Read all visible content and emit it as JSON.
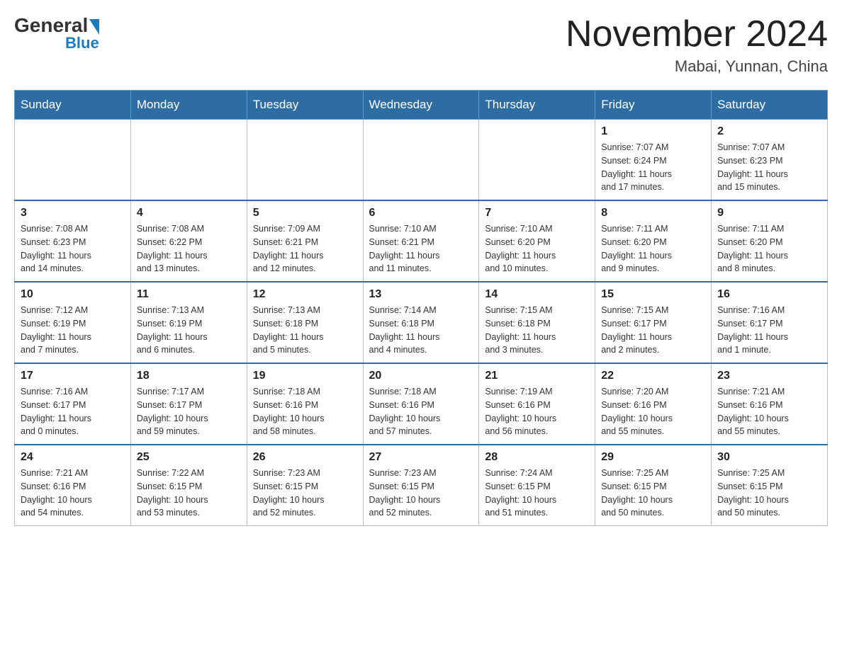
{
  "header": {
    "logo_general": "General",
    "logo_blue": "Blue",
    "month_title": "November 2024",
    "location": "Mabai, Yunnan, China"
  },
  "days_of_week": [
    "Sunday",
    "Monday",
    "Tuesday",
    "Wednesday",
    "Thursday",
    "Friday",
    "Saturday"
  ],
  "weeks": [
    {
      "days": [
        {
          "num": "",
          "info": ""
        },
        {
          "num": "",
          "info": ""
        },
        {
          "num": "",
          "info": ""
        },
        {
          "num": "",
          "info": ""
        },
        {
          "num": "",
          "info": ""
        },
        {
          "num": "1",
          "info": "Sunrise: 7:07 AM\nSunset: 6:24 PM\nDaylight: 11 hours\nand 17 minutes."
        },
        {
          "num": "2",
          "info": "Sunrise: 7:07 AM\nSunset: 6:23 PM\nDaylight: 11 hours\nand 15 minutes."
        }
      ]
    },
    {
      "days": [
        {
          "num": "3",
          "info": "Sunrise: 7:08 AM\nSunset: 6:23 PM\nDaylight: 11 hours\nand 14 minutes."
        },
        {
          "num": "4",
          "info": "Sunrise: 7:08 AM\nSunset: 6:22 PM\nDaylight: 11 hours\nand 13 minutes."
        },
        {
          "num": "5",
          "info": "Sunrise: 7:09 AM\nSunset: 6:21 PM\nDaylight: 11 hours\nand 12 minutes."
        },
        {
          "num": "6",
          "info": "Sunrise: 7:10 AM\nSunset: 6:21 PM\nDaylight: 11 hours\nand 11 minutes."
        },
        {
          "num": "7",
          "info": "Sunrise: 7:10 AM\nSunset: 6:20 PM\nDaylight: 11 hours\nand 10 minutes."
        },
        {
          "num": "8",
          "info": "Sunrise: 7:11 AM\nSunset: 6:20 PM\nDaylight: 11 hours\nand 9 minutes."
        },
        {
          "num": "9",
          "info": "Sunrise: 7:11 AM\nSunset: 6:20 PM\nDaylight: 11 hours\nand 8 minutes."
        }
      ]
    },
    {
      "days": [
        {
          "num": "10",
          "info": "Sunrise: 7:12 AM\nSunset: 6:19 PM\nDaylight: 11 hours\nand 7 minutes."
        },
        {
          "num": "11",
          "info": "Sunrise: 7:13 AM\nSunset: 6:19 PM\nDaylight: 11 hours\nand 6 minutes."
        },
        {
          "num": "12",
          "info": "Sunrise: 7:13 AM\nSunset: 6:18 PM\nDaylight: 11 hours\nand 5 minutes."
        },
        {
          "num": "13",
          "info": "Sunrise: 7:14 AM\nSunset: 6:18 PM\nDaylight: 11 hours\nand 4 minutes."
        },
        {
          "num": "14",
          "info": "Sunrise: 7:15 AM\nSunset: 6:18 PM\nDaylight: 11 hours\nand 3 minutes."
        },
        {
          "num": "15",
          "info": "Sunrise: 7:15 AM\nSunset: 6:17 PM\nDaylight: 11 hours\nand 2 minutes."
        },
        {
          "num": "16",
          "info": "Sunrise: 7:16 AM\nSunset: 6:17 PM\nDaylight: 11 hours\nand 1 minute."
        }
      ]
    },
    {
      "days": [
        {
          "num": "17",
          "info": "Sunrise: 7:16 AM\nSunset: 6:17 PM\nDaylight: 11 hours\nand 0 minutes."
        },
        {
          "num": "18",
          "info": "Sunrise: 7:17 AM\nSunset: 6:17 PM\nDaylight: 10 hours\nand 59 minutes."
        },
        {
          "num": "19",
          "info": "Sunrise: 7:18 AM\nSunset: 6:16 PM\nDaylight: 10 hours\nand 58 minutes."
        },
        {
          "num": "20",
          "info": "Sunrise: 7:18 AM\nSunset: 6:16 PM\nDaylight: 10 hours\nand 57 minutes."
        },
        {
          "num": "21",
          "info": "Sunrise: 7:19 AM\nSunset: 6:16 PM\nDaylight: 10 hours\nand 56 minutes."
        },
        {
          "num": "22",
          "info": "Sunrise: 7:20 AM\nSunset: 6:16 PM\nDaylight: 10 hours\nand 55 minutes."
        },
        {
          "num": "23",
          "info": "Sunrise: 7:21 AM\nSunset: 6:16 PM\nDaylight: 10 hours\nand 55 minutes."
        }
      ]
    },
    {
      "days": [
        {
          "num": "24",
          "info": "Sunrise: 7:21 AM\nSunset: 6:16 PM\nDaylight: 10 hours\nand 54 minutes."
        },
        {
          "num": "25",
          "info": "Sunrise: 7:22 AM\nSunset: 6:15 PM\nDaylight: 10 hours\nand 53 minutes."
        },
        {
          "num": "26",
          "info": "Sunrise: 7:23 AM\nSunset: 6:15 PM\nDaylight: 10 hours\nand 52 minutes."
        },
        {
          "num": "27",
          "info": "Sunrise: 7:23 AM\nSunset: 6:15 PM\nDaylight: 10 hours\nand 52 minutes."
        },
        {
          "num": "28",
          "info": "Sunrise: 7:24 AM\nSunset: 6:15 PM\nDaylight: 10 hours\nand 51 minutes."
        },
        {
          "num": "29",
          "info": "Sunrise: 7:25 AM\nSunset: 6:15 PM\nDaylight: 10 hours\nand 50 minutes."
        },
        {
          "num": "30",
          "info": "Sunrise: 7:25 AM\nSunset: 6:15 PM\nDaylight: 10 hours\nand 50 minutes."
        }
      ]
    }
  ]
}
